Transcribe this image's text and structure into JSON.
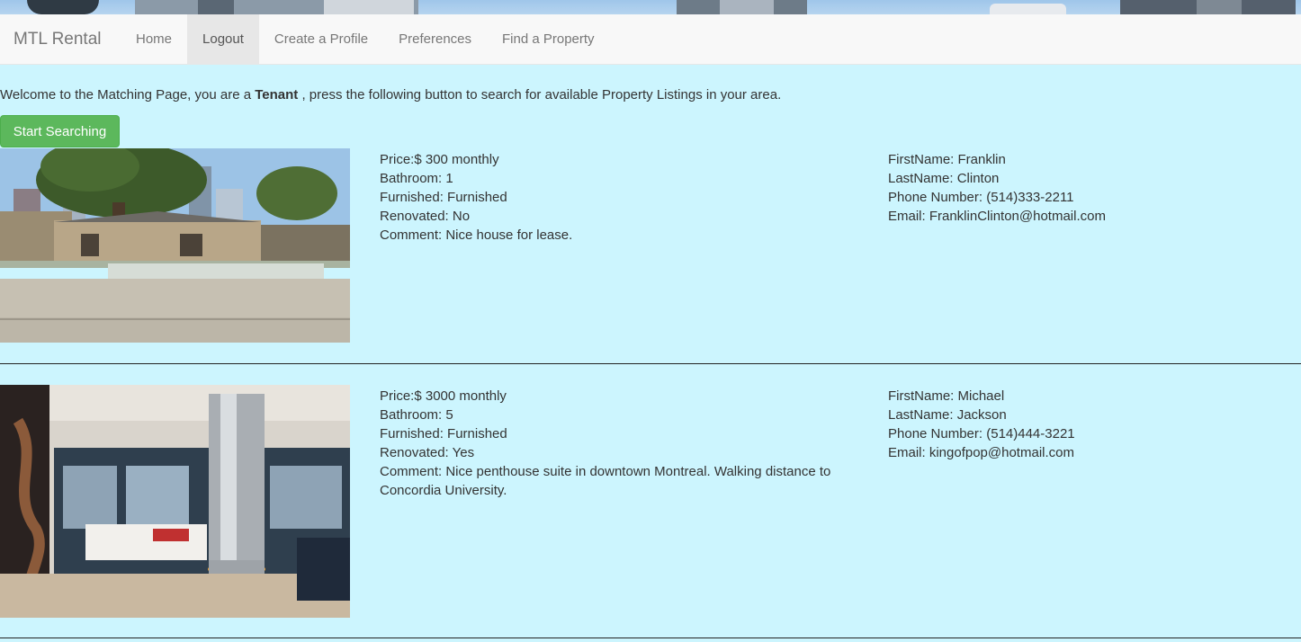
{
  "navbar": {
    "brand": "MTL Rental",
    "items": [
      {
        "label": "Home"
      },
      {
        "label": "Logout"
      },
      {
        "label": "Create a Profile"
      },
      {
        "label": "Preferences"
      },
      {
        "label": "Find a Property"
      }
    ],
    "active_index": 1
  },
  "welcome": {
    "prefix": "Welcome to the Matching Page, you are a",
    "role": "Tenant",
    "suffix": ", press the following button to search for available Property Listings in your area."
  },
  "search_button": "Start Searching",
  "listings": [
    {
      "price": "Price:$ 300 monthly",
      "bathroom": "Bathroom: 1",
      "furnished": "Furnished: Furnished",
      "renovated": "Renovated: No",
      "comment": "Comment: Nice house for lease.",
      "firstname": "FirstName: Franklin",
      "lastname": "LastName: Clinton",
      "phone": "Phone Number: (514)333-2211",
      "email": "Email: FranklinClinton@hotmail.com"
    },
    {
      "price": "Price:$ 3000 monthly",
      "bathroom": "Bathroom: 5",
      "furnished": "Furnished: Furnished",
      "renovated": "Renovated: Yes",
      "comment": "Comment: Nice penthouse suite in downtown Montreal. Walking distance to Concordia University.",
      "firstname": "FirstName: Michael",
      "lastname": "LastName: Jackson",
      "phone": "Phone Number: (514)444-3221",
      "email": "Email: kingofpop@hotmail.com"
    }
  ],
  "colors": {
    "page_background": "#ccf5fe",
    "button_green": "#5cb85c",
    "navbar_background": "#f8f8f8"
  }
}
